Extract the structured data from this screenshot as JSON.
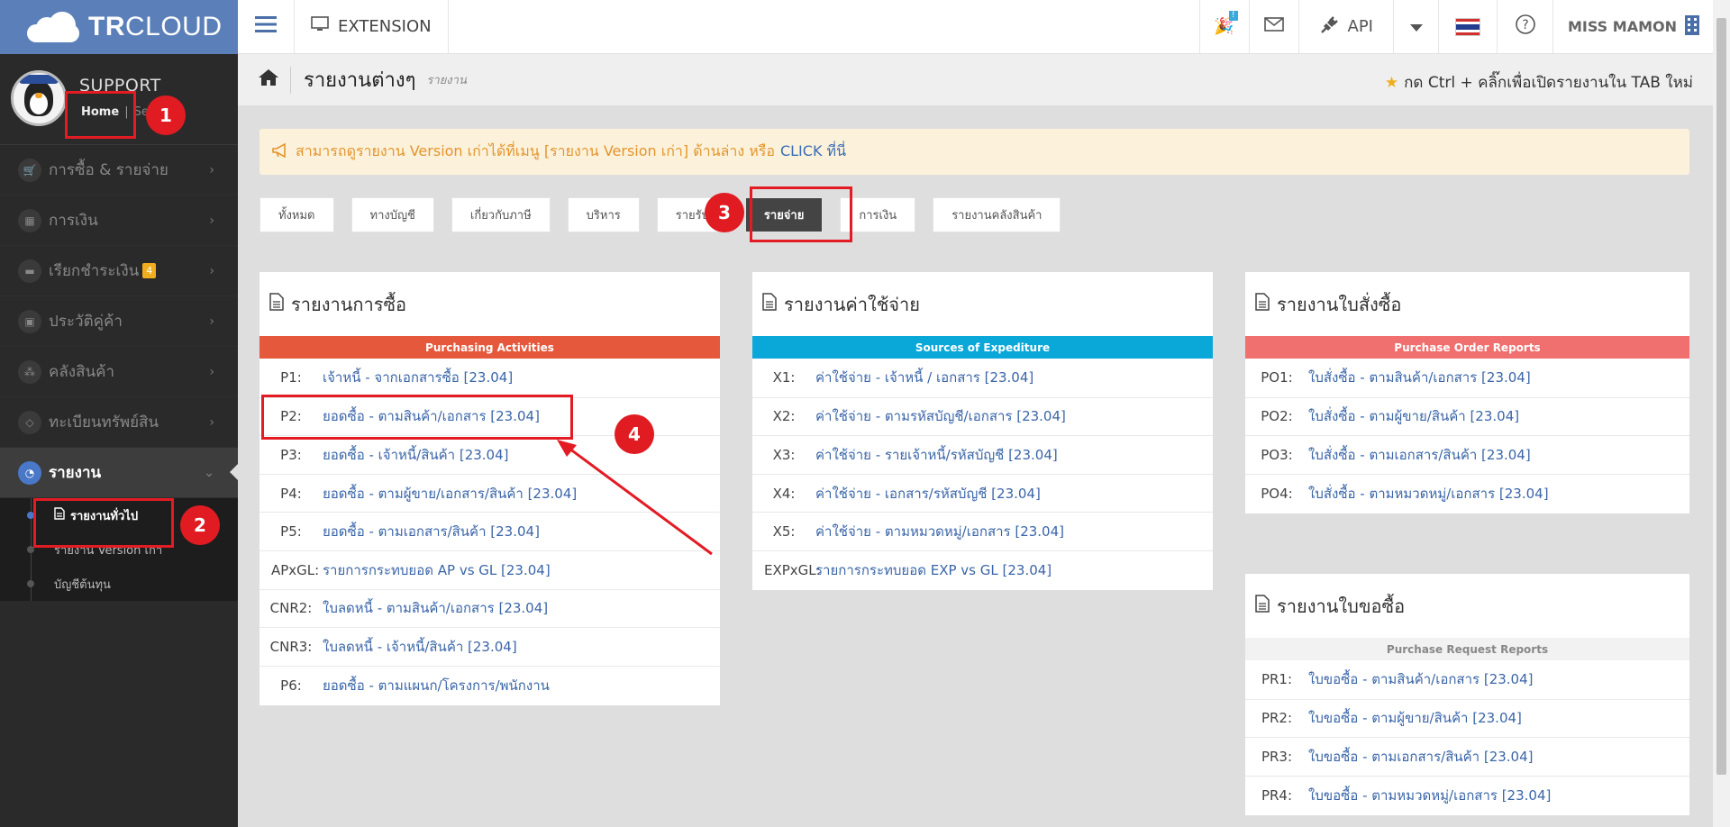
{
  "brand": {
    "bold": "TR",
    "light": "CLOUD"
  },
  "topbar": {
    "extension_label": "EXTENSION",
    "notify_badge": "!",
    "api_label": "API",
    "user_name": "MISS MAMON"
  },
  "profile": {
    "name": "SUPPORT",
    "home_link": "Home",
    "sep": "|",
    "settings_link": "Se"
  },
  "sidebar": {
    "items": [
      {
        "label": "การซื้อ & รายจ่าย",
        "icon": "cart-icon"
      },
      {
        "label": "การเงิน",
        "icon": "calendar-icon"
      },
      {
        "label": "เรียกชำระเงิน",
        "icon": "card-icon",
        "badge": "4"
      },
      {
        "label": "ประวัติคู่ค้า",
        "icon": "contact-icon"
      },
      {
        "label": "คลังสินค้า",
        "icon": "boxes-icon"
      },
      {
        "label": "ทะเบียนทรัพย์สิน",
        "icon": "diamond-icon"
      },
      {
        "label": "รายงาน",
        "icon": "report-icon"
      }
    ],
    "sub_items": [
      {
        "label": "รายงานทั่วไป"
      },
      {
        "label": "รายงาน Version เก่า"
      },
      {
        "label": "บัญชีต้นทุน"
      }
    ]
  },
  "page": {
    "title": "รายงานต่างๆ",
    "subtitle": "รายงาน",
    "tip": "กด Ctrl + คลิ๊กเพื่อเปิดรายงานใน TAB ใหม่"
  },
  "notice": {
    "text": "สามารถดูรายงาน Version เก่าได้ที่เมนู [รายงาน Version เก่า] ด้านล่าง หรือ ",
    "click": "CLICK ที่นี่"
  },
  "tabs": [
    "ทั้งหมด",
    "ทางบัญชี",
    "เกี่ยวกับภาษี",
    "บริหาร",
    "รายรับ",
    "รายจ่าย",
    "การเงิน",
    "รายงานคลังสินค้า"
  ],
  "panels": {
    "purchase": {
      "title": "รายงานการซื้อ",
      "band": "Purchasing Activities",
      "band_color": "#e5583b",
      "rows": [
        {
          "code": "P1:",
          "name": "เจ้าหนี้ - จากเอกสารซื้อ [23.04]"
        },
        {
          "code": "P2:",
          "name": "ยอดซื้อ - ตามสินค้า/เอกสาร [23.04]"
        },
        {
          "code": "P3:",
          "name": "ยอดซื้อ - เจ้าหนี้/สินค้า [23.04]"
        },
        {
          "code": "P4:",
          "name": "ยอดซื้อ - ตามผู้ขาย/เอกสาร/สินค้า [23.04]"
        },
        {
          "code": "P5:",
          "name": "ยอดซื้อ - ตามเอกสาร/สินค้า [23.04]"
        },
        {
          "code": "APxGL:",
          "name": "รายการกระทบยอด AP vs GL [23.04]"
        },
        {
          "code": "CNR2:",
          "name": "ใบลดหนี้ - ตามสินค้า/เอกสาร [23.04]"
        },
        {
          "code": "CNR3:",
          "name": "ใบลดหนี้ - เจ้าหนี้/สินค้า [23.04]"
        },
        {
          "code": "P6:",
          "name": "ยอดซื้อ - ตามแผนก/โครงการ/พนักงาน"
        }
      ]
    },
    "expense": {
      "title": "รายงานค่าใช้จ่าย",
      "band": "Sources of Expediture",
      "band_color": "#0aa7d9",
      "rows": [
        {
          "code": "X1:",
          "name": "ค่าใช้จ่าย - เจ้าหนี้ / เอกสาร [23.04]"
        },
        {
          "code": "X2:",
          "name": "ค่าใช้จ่าย - ตามรหัสบัญชี/เอกสาร [23.04]"
        },
        {
          "code": "X3:",
          "name": "ค่าใช้จ่าย - รายเจ้าหนี้/รหัสบัญชี [23.04]"
        },
        {
          "code": "X4:",
          "name": "ค่าใช้จ่าย - เอกสาร/รหัสบัญชี [23.04]"
        },
        {
          "code": "X5:",
          "name": "ค่าใช้จ่าย - ตามหมวดหมู่/เอกสาร [23.04]"
        },
        {
          "code": "EXPxGL:",
          "name": "รายการกระทบยอด EXP vs GL [23.04]"
        }
      ]
    },
    "po": {
      "title": "รายงานใบสั่งซื้อ",
      "band": "Purchase Order Reports",
      "band_color": "#f07070",
      "rows": [
        {
          "code": "PO1:",
          "name": "ใบสั่งซื้อ - ตามสินค้า/เอกสาร [23.04]"
        },
        {
          "code": "PO2:",
          "name": "ใบสั่งซื้อ - ตามผู้ขาย/สินค้า [23.04]"
        },
        {
          "code": "PO3:",
          "name": "ใบสั่งซื้อ - ตามเอกสาร/สินค้า [23.04]"
        },
        {
          "code": "PO4:",
          "name": "ใบสั่งซื้อ - ตามหมวดหมู่/เอกสาร [23.04]"
        }
      ]
    },
    "pr": {
      "title": "รายงานใบขอซื้อ",
      "band": "Purchase Request Reports",
      "band_color": "#f2f2f2",
      "rows": [
        {
          "code": "PR1:",
          "name": "ใบขอซื้อ - ตามสินค้า/เอกสาร [23.04]"
        },
        {
          "code": "PR2:",
          "name": "ใบขอซื้อ - ตามผู้ขาย/สินค้า [23.04]"
        },
        {
          "code": "PR3:",
          "name": "ใบขอซื้อ - ตามเอกสาร/สินค้า [23.04]"
        },
        {
          "code": "PR4:",
          "name": "ใบขอซื้อ - ตามหมวดหมู่/เอกสาร [23.04]"
        }
      ]
    }
  },
  "annotations": [
    "1",
    "2",
    "3",
    "4"
  ]
}
